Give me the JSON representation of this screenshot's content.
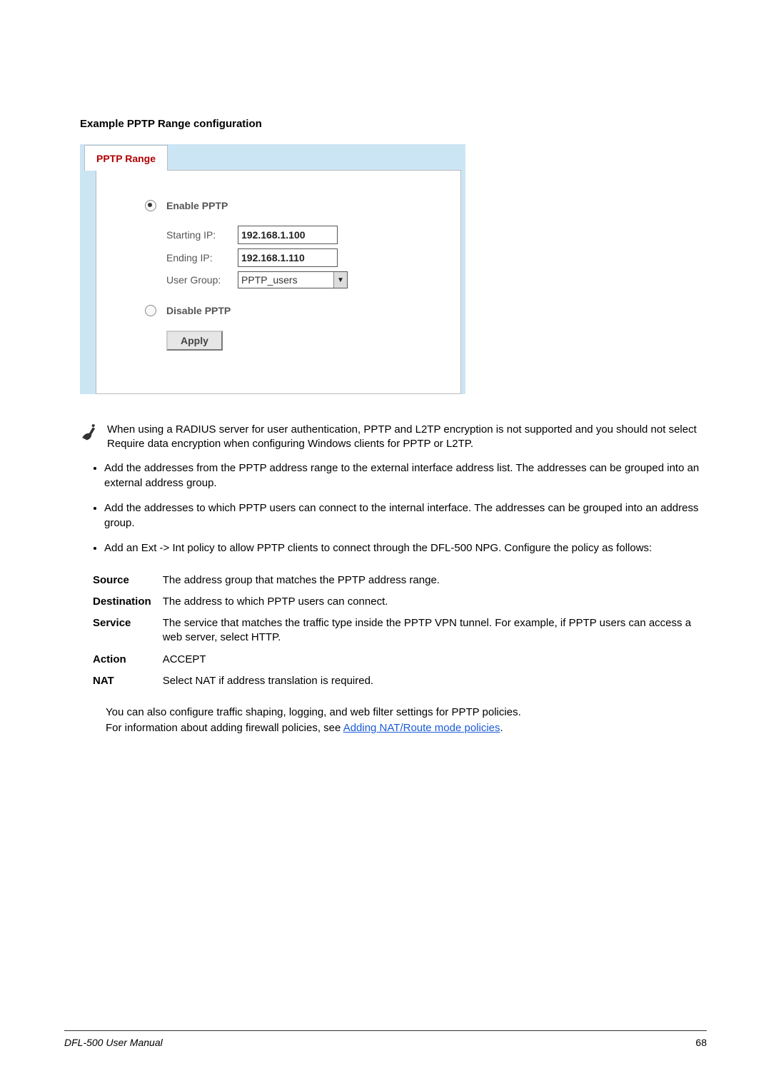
{
  "heading": "Example PPTP Range configuration",
  "shot": {
    "tab": "PPTP Range",
    "enable_label": "Enable PPTP",
    "starting_ip_label": "Starting IP:",
    "starting_ip_value": "192.168.1.100",
    "ending_ip_label": "Ending IP:",
    "ending_ip_value": "192.168.1.110",
    "user_group_label": "User Group:",
    "user_group_value": "PPTP_users",
    "disable_label": "Disable PPTP",
    "apply": "Apply"
  },
  "note": "When using a RADIUS server for user authentication, PPTP and L2TP encryption is not supported and you should not select Require data encryption when configuring Windows clients for PPTP or L2TP.",
  "bullets": [
    "Add the addresses from the PPTP address range to the external interface address list. The addresses can be grouped into an external address group.",
    "Add the addresses to which PPTP users can connect to the internal interface. The addresses can be grouped into an address group.",
    "Add an Ext -> Int policy to allow PPTP clients to connect through the DFL-500 NPG. Configure the policy as follows:"
  ],
  "policy": {
    "source_k": "Source",
    "source_v": "The address group that matches the PPTP address range.",
    "dest_k": "Destination",
    "dest_v": "The address to which PPTP users can connect.",
    "service_k": "Service",
    "service_v": "The service that matches the traffic type inside the PPTP VPN tunnel. For example, if PPTP users can access a web server, select HTTP.",
    "action_k": "Action",
    "action_v": "ACCEPT",
    "nat_k": "NAT",
    "nat_v": "Select NAT if address translation is required."
  },
  "closing_line1": "You can also configure traffic shaping, logging, and web filter settings for PPTP policies.",
  "closing_prefix": "For information about adding firewall policies, see ",
  "closing_link": "Adding NAT/Route mode policies",
  "closing_suffix": ".",
  "footer_left": "DFL-500 User Manual",
  "footer_right": "68"
}
